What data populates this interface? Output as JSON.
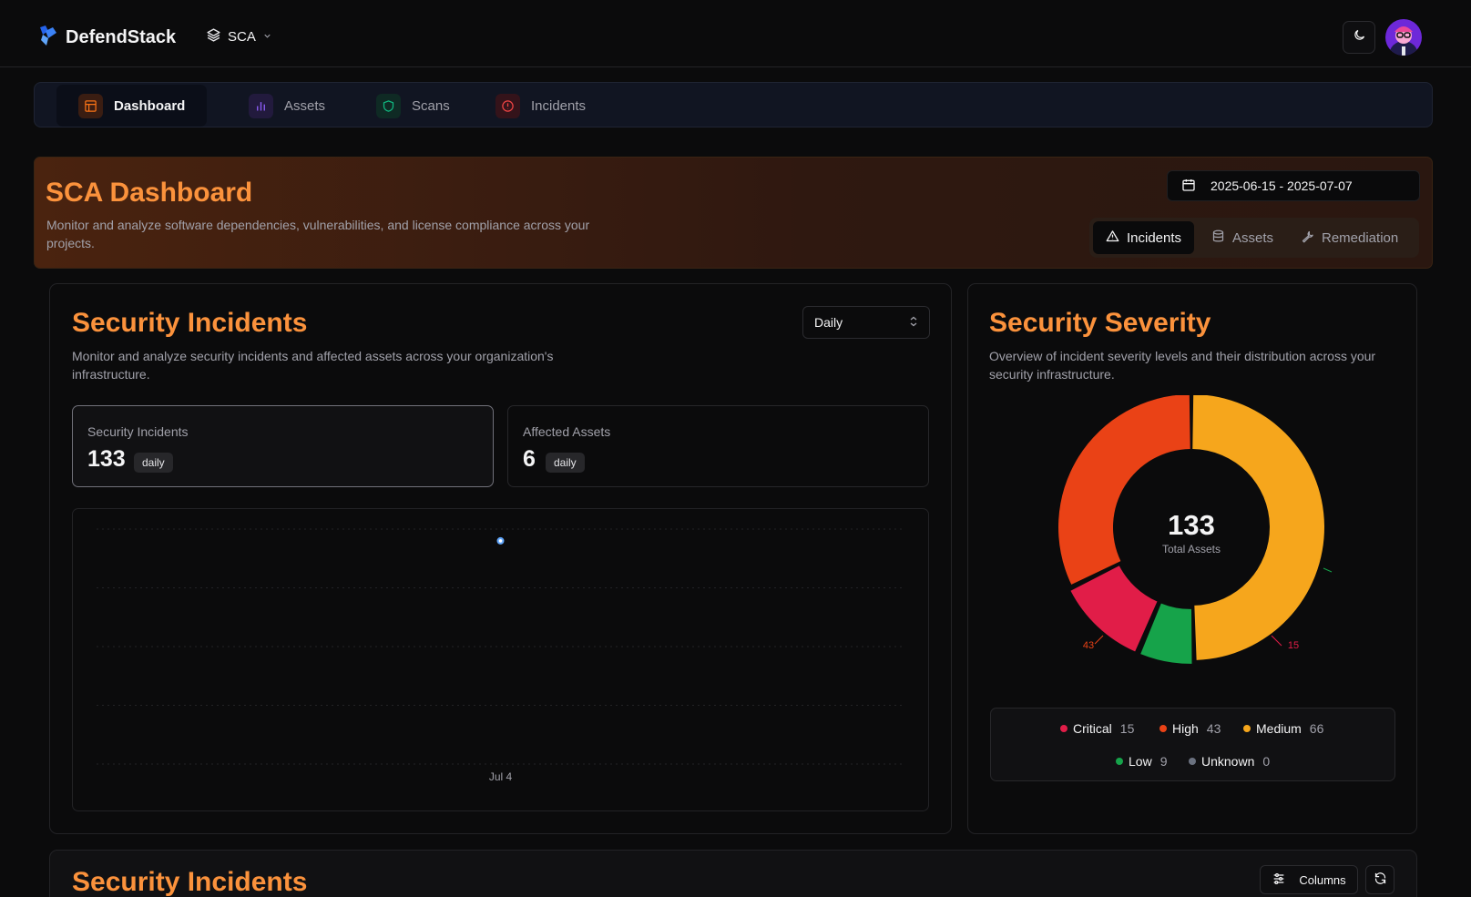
{
  "app": {
    "brand": "DefendStack",
    "project": "SCA"
  },
  "nav": {
    "tabs": [
      {
        "label": "Dashboard",
        "icon": "layout-icon",
        "color": "#f97316"
      },
      {
        "label": "Assets",
        "icon": "bar-chart-icon",
        "color": "#8b5cf6"
      },
      {
        "label": "Scans",
        "icon": "shield-icon",
        "color": "#10b981"
      },
      {
        "label": "Incidents",
        "icon": "alert-circle-icon",
        "color": "#ef4444"
      }
    ]
  },
  "header": {
    "title": "SCA Dashboard",
    "subtitle": "Monitor and analyze software dependencies, vulnerabilities, and license compliance across your projects.",
    "date_range": "2025-06-15 - 2025-07-07",
    "views": [
      "Incidents",
      "Assets",
      "Remediation"
    ]
  },
  "incidents_card": {
    "title": "Security Incidents",
    "subtitle": "Monitor and analyze security incidents and affected assets across your organization's infrastructure.",
    "interval": "Daily",
    "stats": [
      {
        "label": "Security Incidents",
        "value": "133",
        "badge": "daily"
      },
      {
        "label": "Affected Assets",
        "value": "6",
        "badge": "daily"
      }
    ]
  },
  "severity_card": {
    "title": "Security Severity",
    "subtitle": "Overview of incident severity levels and their distribution across your security infrastructure.",
    "center_value": "133",
    "center_label": "Total Assets",
    "legend": [
      {
        "label": "Critical",
        "count": "15",
        "color": "#e11d48"
      },
      {
        "label": "High",
        "count": "43",
        "color": "#ea4216"
      },
      {
        "label": "Medium",
        "count": "66",
        "color": "#f6a61c"
      },
      {
        "label": "Low",
        "count": "9",
        "color": "#16a34a"
      },
      {
        "label": "Unknown",
        "count": "0",
        "color": "#6b7280"
      }
    ],
    "slice_labels": {
      "critical": "15",
      "high": "43"
    }
  },
  "table_card": {
    "title": "Security Incidents",
    "columns_button": "Columns"
  },
  "chart_data": [
    {
      "type": "line",
      "x": [
        "Jul 4"
      ],
      "series": [
        {
          "values": [
            133
          ]
        }
      ],
      "tick_labels": [
        "Jul 4"
      ],
      "grid": true
    },
    {
      "type": "pie",
      "categories": [
        "Critical",
        "High",
        "Medium",
        "Low",
        "Unknown"
      ],
      "values": [
        15,
        43,
        66,
        9,
        0
      ],
      "title": "",
      "center_text": "133 Total Assets"
    }
  ]
}
